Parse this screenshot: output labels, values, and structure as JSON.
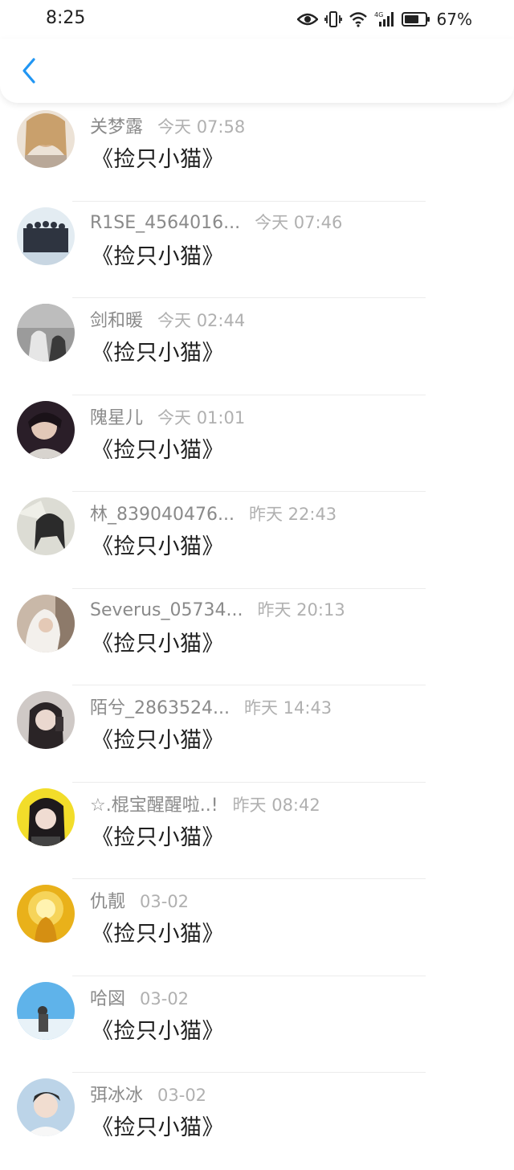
{
  "status_bar": {
    "time": "8:25",
    "battery": "67%",
    "icons": [
      "eye-icon",
      "vibrate-icon",
      "wifi-icon",
      "signal-4g-icon",
      "battery-icon"
    ]
  },
  "header": {
    "back_icon": "chevron-left-icon",
    "accent_color": "#2196f3"
  },
  "messages": [
    {
      "name": "关梦露",
      "time": "今天 07:58",
      "text": "《捡只小猫》"
    },
    {
      "name": "R1SE_4564016...",
      "time": "今天 07:46",
      "text": "《捡只小猫》"
    },
    {
      "name": "剑和暖",
      "time": "今天 02:44",
      "text": "《捡只小猫》"
    },
    {
      "name": "隗星儿",
      "time": "今天 01:01",
      "text": "《捡只小猫》"
    },
    {
      "name": "林_839040476...",
      "time": "昨天 22:43",
      "text": "《捡只小猫》"
    },
    {
      "name": "Severus_05734...",
      "time": "昨天 20:13",
      "text": "《捡只小猫》"
    },
    {
      "name": "陌兮_2863524...",
      "time": "昨天 14:43",
      "text": "《捡只小猫》"
    },
    {
      "name": "☆.棍宝醒醒啦..!",
      "time": "昨天 08:42",
      "text": "《捡只小猫》"
    },
    {
      "name": "仇靓",
      "time": "03-02",
      "text": "《捡只小猫》"
    },
    {
      "name": "哈図",
      "time": "03-02",
      "text": "《捡只小猫》"
    },
    {
      "name": "弭冰冰",
      "time": "03-02",
      "text": "《捡只小猫》"
    }
  ]
}
